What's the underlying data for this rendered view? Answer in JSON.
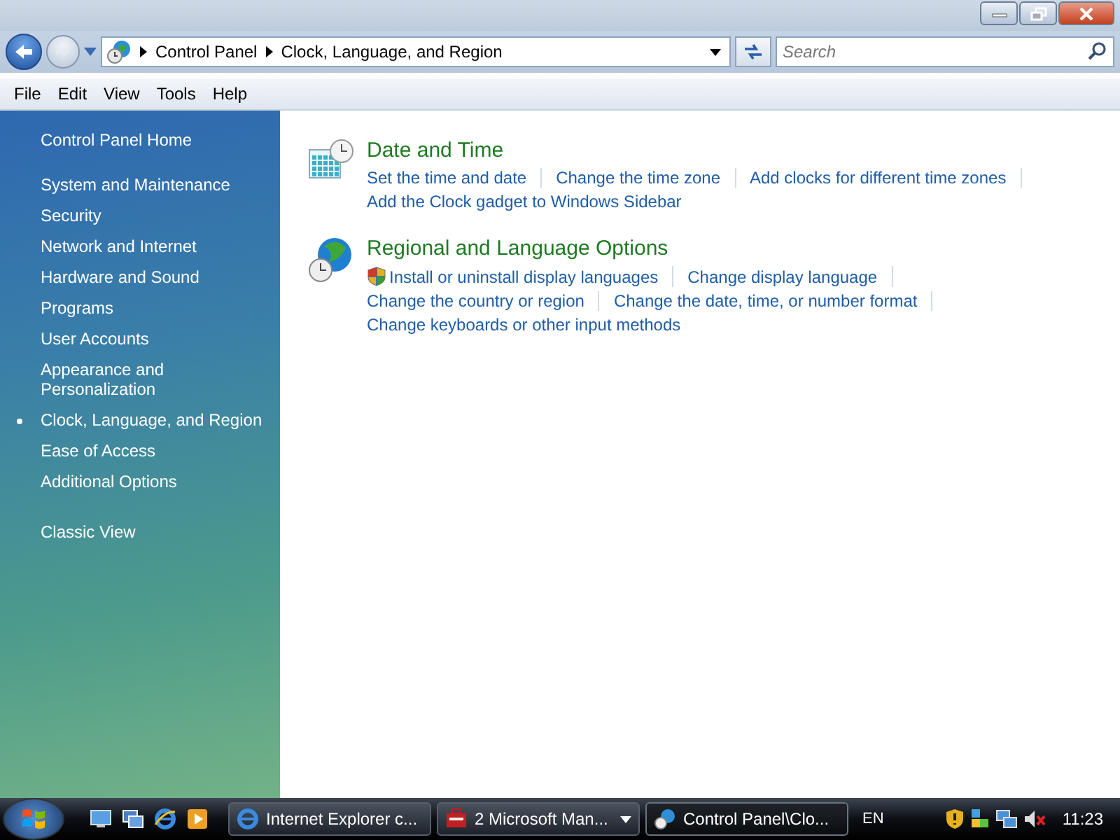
{
  "address_bar": {
    "breadcrumbs": [
      "Control Panel",
      "Clock, Language, and Region"
    ]
  },
  "search": {
    "placeholder": "Search"
  },
  "menu": [
    "File",
    "Edit",
    "View",
    "Tools",
    "Help"
  ],
  "sidebar": {
    "home": "Control Panel Home",
    "items": [
      {
        "label": "System and Maintenance",
        "selected": false
      },
      {
        "label": "Security",
        "selected": false
      },
      {
        "label": "Network and Internet",
        "selected": false
      },
      {
        "label": "Hardware and Sound",
        "selected": false
      },
      {
        "label": "Programs",
        "selected": false
      },
      {
        "label": "User Accounts",
        "selected": false
      },
      {
        "label": "Appearance and Personalization",
        "selected": false
      },
      {
        "label": "Clock, Language, and Region",
        "selected": true
      },
      {
        "label": "Ease of Access",
        "selected": false
      },
      {
        "label": "Additional Options",
        "selected": false
      }
    ],
    "classic_view": "Classic View"
  },
  "sections": [
    {
      "kind": "clock",
      "title": "Date and Time",
      "lines": [
        [
          {
            "label": "Set the time and date",
            "shield": false
          },
          {
            "label": "Change the time zone",
            "shield": false
          },
          {
            "label": "Add clocks for different time zones",
            "shield": false
          }
        ],
        [
          {
            "label": "Add the Clock gadget to Windows Sidebar",
            "shield": false
          }
        ]
      ]
    },
    {
      "kind": "globe",
      "title": "Regional and Language Options",
      "lines": [
        [
          {
            "label": "Install or uninstall display languages",
            "shield": true
          },
          {
            "label": "Change display language",
            "shield": false
          }
        ],
        [
          {
            "label": "Change the country or region",
            "shield": false
          },
          {
            "label": "Change the date, time, or number format",
            "shield": false
          }
        ],
        [
          {
            "label": "Change keyboards or other input methods",
            "shield": false
          }
        ]
      ]
    }
  ],
  "taskbar": {
    "buttons": [
      {
        "label": "Internet Explorer c...",
        "kind": "browser",
        "selected": false,
        "grouped": false
      },
      {
        "label": "2 Microsoft Man...",
        "kind": "console",
        "selected": false,
        "grouped": true
      },
      {
        "label": "Control Panel\\Clo...",
        "kind": "panel",
        "selected": true,
        "grouped": false
      }
    ],
    "language": "EN",
    "clock": "11:23"
  }
}
